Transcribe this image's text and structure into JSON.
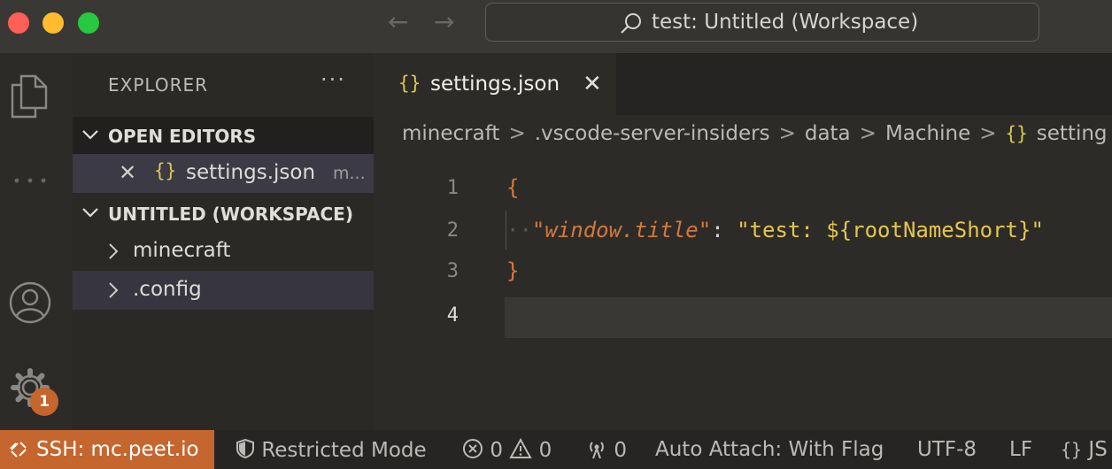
{
  "titlebar": {
    "command_center_title": "test: Untitled (Workspace)",
    "back_icon": "arrow-left-icon",
    "forward_icon": "arrow-right-icon"
  },
  "activity": {
    "settings_badge": "1"
  },
  "sidebar": {
    "title": "EXPLORER",
    "more": "···",
    "open_editors": {
      "label": "OPEN EDITORS",
      "items": [
        {
          "name": "settings.json",
          "detail": "m..."
        }
      ]
    },
    "workspace": {
      "label": "UNTITLED (WORKSPACE)",
      "folders": [
        "minecraft",
        ".config"
      ]
    }
  },
  "editor": {
    "tab": {
      "name": "settings.json"
    },
    "breadcrumb": [
      "minecraft",
      ".vscode-server-insiders",
      "data",
      "Machine",
      "setting"
    ],
    "lines": [
      "1",
      "2",
      "3",
      "4"
    ],
    "code": {
      "open_brace": "{",
      "key": "\"window.title\"",
      "colon": ": ",
      "value": "\"test: ${rootNameShort}\"",
      "close_brace": "}"
    }
  },
  "statusbar": {
    "remote": "SSH: mc.peet.io",
    "restricted": "Restricted Mode",
    "errors": "0",
    "warnings": "0",
    "ports": "0",
    "auto_attach": "Auto Attach: With Flag",
    "encoding": "UTF-8",
    "eol": "LF",
    "language": "JS"
  },
  "colors": {
    "accent_remote": "#c5662e",
    "json_brace_icon": "#d9c94d"
  }
}
